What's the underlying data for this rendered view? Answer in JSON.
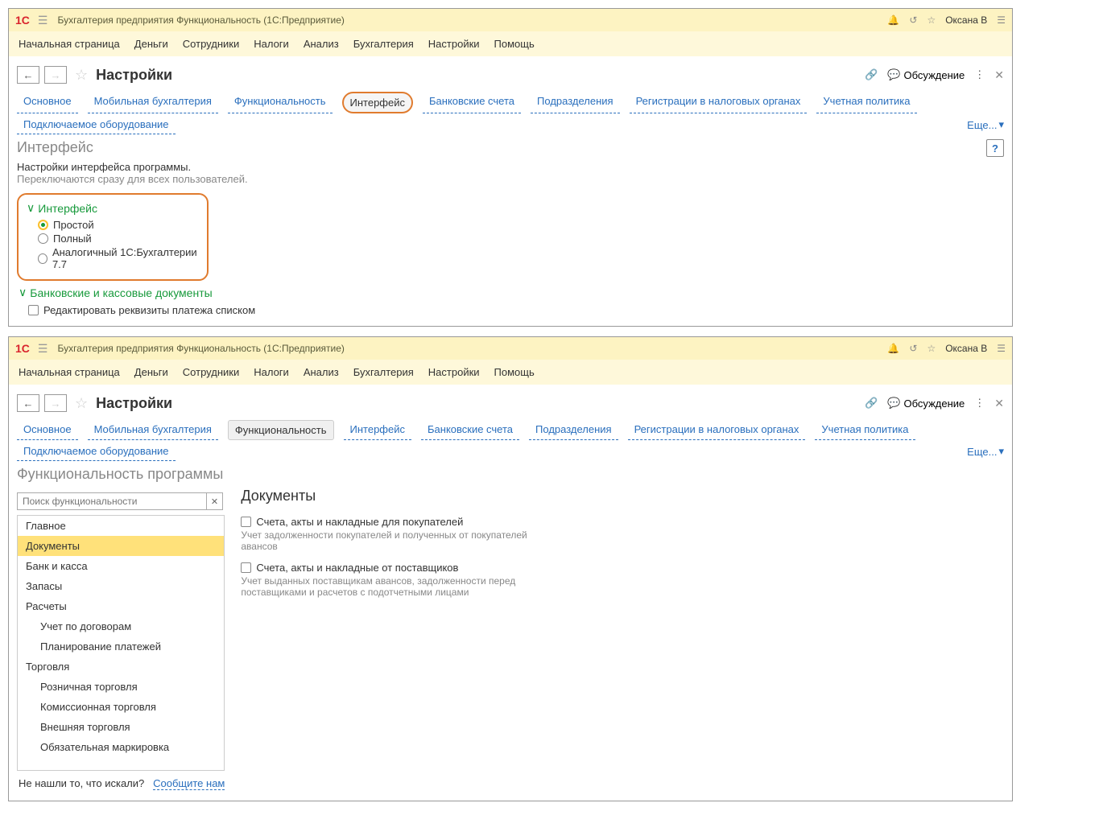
{
  "app": {
    "logo": "1C",
    "title": "Бухгалтерия предприятия Функциональность  (1С:Предприятие)",
    "user": "Оксана В"
  },
  "menu": [
    "Начальная страница",
    "Деньги",
    "Сотрудники",
    "Налоги",
    "Анализ",
    "Бухгалтерия",
    "Настройки",
    "Помощь"
  ],
  "page1": {
    "title": "Настройки",
    "discuss": "Обсуждение",
    "tabs": [
      "Основное",
      "Мобильная бухгалтерия",
      "Функциональность",
      "Интерфейс",
      "Банковские счета",
      "Подразделения",
      "Регистрации в налоговых органах",
      "Учетная политика",
      "Подключаемое оборудование"
    ],
    "more": "Еще...",
    "section": "Интерфейс",
    "desc1": "Настройки интерфейса программы.",
    "desc2": "Переключаются сразу для всех пользователей.",
    "grp1": "Интерфейс",
    "radios": [
      "Простой",
      "Полный",
      "Аналогичный 1С:Бухгалтерии 7.7"
    ],
    "grp2": "Банковские и кассовые документы",
    "chk1": "Редактировать реквизиты платежа списком"
  },
  "page2": {
    "title": "Настройки",
    "discuss": "Обсуждение",
    "tabs": [
      "Основное",
      "Мобильная бухгалтерия",
      "Функциональность",
      "Интерфейс",
      "Банковские счета",
      "Подразделения",
      "Регистрации в налоговых органах",
      "Учетная политика",
      "Подключаемое оборудование"
    ],
    "more": "Еще...",
    "section": "Функциональность программы",
    "search_placeholder": "Поиск функциональности",
    "tree": [
      "Главное",
      "Документы",
      "Банк и касса",
      "Запасы",
      "Расчеты",
      "Учет по договорам",
      "Планирование платежей",
      "Торговля",
      "Розничная торговля",
      "Комиссионная торговля",
      "Внешняя торговля",
      "Обязательная маркировка"
    ],
    "tree_sub_idx": [
      5,
      6,
      8,
      9,
      10,
      11
    ],
    "right_title": "Документы",
    "opt1": "Счета, акты и накладные для покупателей",
    "opt1d": "Учет задолженности покупателей и полученных от покупателей авансов",
    "opt2": "Счета, акты и накладные от поставщиков",
    "opt2d": "Учет выданных поставщикам авансов, задолженности перед поставщиками и расчетов с подотчетными лицами",
    "footer_text": "Не нашли то, что искали?",
    "footer_link": "Сообщите нам"
  }
}
